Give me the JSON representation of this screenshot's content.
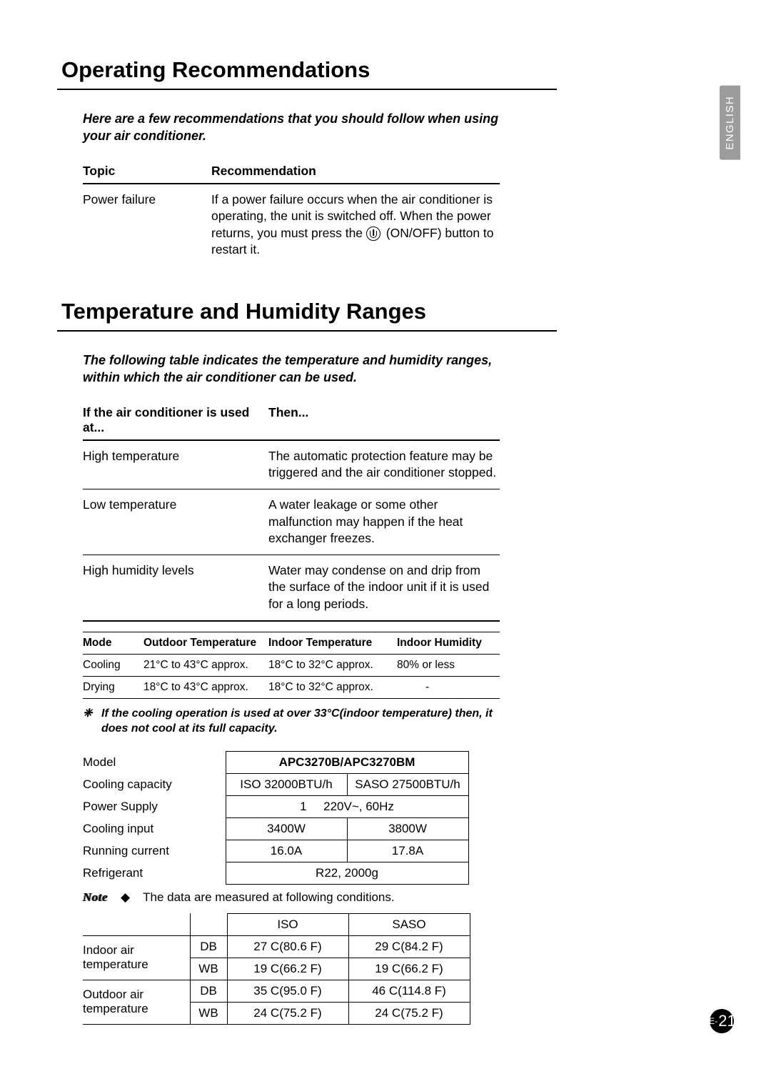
{
  "language_tab": "ENGLISH",
  "section1": {
    "title": "Operating Recommendations",
    "intro": "Here are a few recommendations that you should follow when using your air conditioner.",
    "headers": {
      "topic": "Topic",
      "rec": "Recommendation"
    },
    "rows": [
      {
        "topic": "Power failure",
        "rec_pre": "If a power failure occurs when the air conditioner is operating, the unit is switched off. When the power returns, you must press the ",
        "rec_post": " (ON/OFF) button to restart it."
      }
    ]
  },
  "section2": {
    "title": "Temperature and Humidity Ranges",
    "intro": "The following table indicates the temperature and humidity ranges, within which the air conditioner can be used.",
    "headers": {
      "cond": "If the air conditioner is used at...",
      "then": "Then..."
    },
    "rows": [
      {
        "cond": "High temperature",
        "then": "The automatic protection feature may be triggered and the air conditioner stopped."
      },
      {
        "cond": "Low temperature",
        "then": "A water leakage or some other malfunction may happen if the heat exchanger freezes."
      },
      {
        "cond": "High humidity levels",
        "then": "Water may condense on and drip from the surface of the indoor unit if it is used for a long periods."
      }
    ],
    "mode_headers": {
      "mode": "Mode",
      "out": "Outdoor Temperature",
      "in": "Indoor Temperature",
      "hum": "Indoor Humidity"
    },
    "mode_rows": [
      {
        "mode": "Cooling",
        "out": "21°C to 43°C approx.",
        "in": "18°C to 32°C approx.",
        "hum": "80% or less"
      },
      {
        "mode": "Drying",
        "out": "18°C to 43°C approx.",
        "in": "18°C to 32°C approx.",
        "hum": "-"
      }
    ],
    "footnote_mark": "❈",
    "footnote": "If the cooling operation is used at over 33°C(indoor temperature) then, it does not cool at its full capacity."
  },
  "spec": {
    "model_label": "Model",
    "model_value": "APC3270B/APC3270BM",
    "rows": [
      {
        "label": "Cooling capacity",
        "c1": "ISO 32000BTU/h",
        "c2": "SASO 27500BTU/h"
      },
      {
        "label": "Power Supply",
        "span": "1     220V~, 60Hz"
      },
      {
        "label": "Cooling input",
        "c1": "3400W",
        "c2": "3800W"
      },
      {
        "label": "Running current",
        "c1": "16.0A",
        "c2": "17.8A"
      },
      {
        "label": "Refrigerant",
        "span": "R22, 2000g"
      }
    ]
  },
  "note": {
    "word": "Note",
    "bullet": "◆",
    "text": "The data are measured at following conditions."
  },
  "cond": {
    "headers": {
      "iso": "ISO",
      "saso": "SASO"
    },
    "indoor_label": "Indoor air temperature",
    "outdoor_label": "Outdoor air temperature",
    "indoor": [
      {
        "type": "DB",
        "iso": "27 C(80.6 F)",
        "saso": "29 C(84.2 F)"
      },
      {
        "type": "WB",
        "iso": "19 C(66.2 F)",
        "saso": "19 C(66.2 F)"
      }
    ],
    "outdoor": [
      {
        "type": "DB",
        "iso": "35 C(95.0 F)",
        "saso": "46 C(114.8 F)"
      },
      {
        "type": "WB",
        "iso": "24 C(75.2 F)",
        "saso": "24 C(75.2 F)"
      }
    ]
  },
  "page_number": {
    "prefix": "E-",
    "num": "21"
  }
}
